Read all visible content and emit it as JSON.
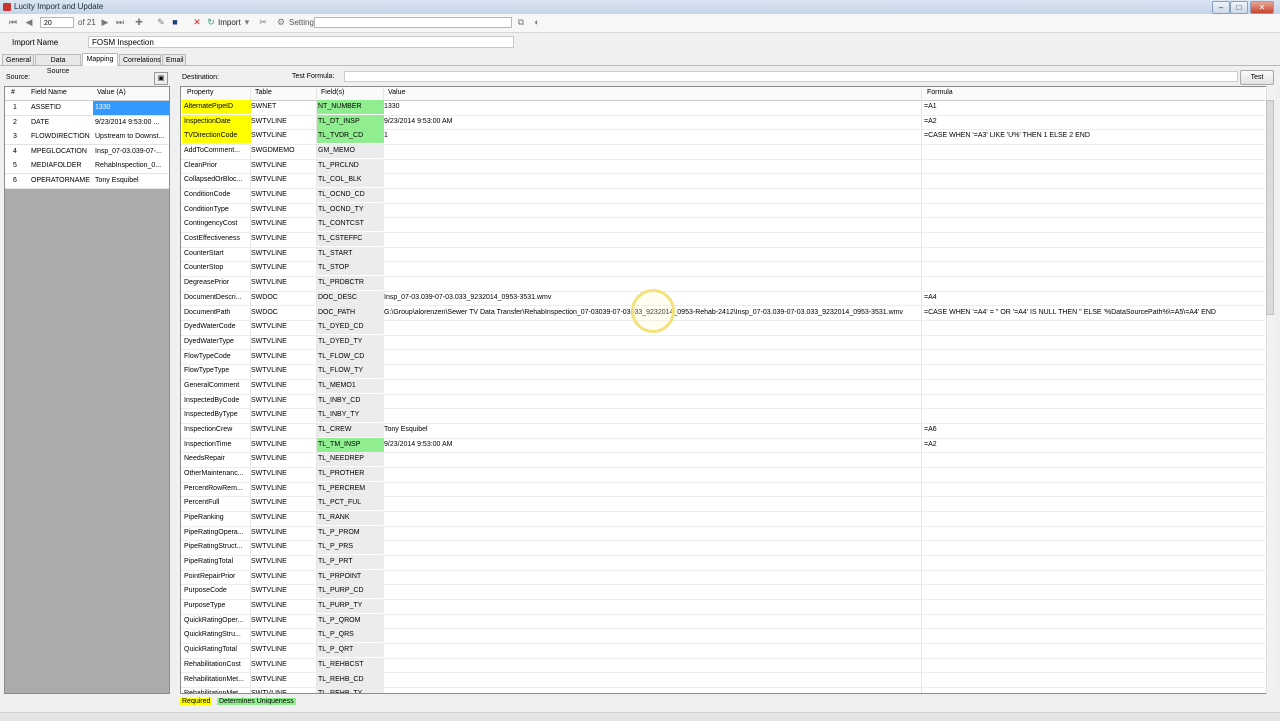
{
  "window": {
    "title": "Lucity Import and Update",
    "min": "–",
    "max": "□",
    "close": "✕"
  },
  "toolbar": {
    "record": "20",
    "of": "of 21",
    "import": "Import",
    "setting": "Setting:"
  },
  "import_name": {
    "label": "Import Name",
    "value": "FOSM Inspection"
  },
  "tabs": [
    "General",
    "Data Source",
    "Mapping",
    "Correlations",
    "Email"
  ],
  "source": {
    "label": "Source:",
    "headers": [
      "#",
      "Field Name",
      "Value (A)"
    ],
    "rows": [
      {
        "n": "1",
        "field": "ASSETID",
        "value": "1330"
      },
      {
        "n": "2",
        "field": "DATE",
        "value": "9/23/2014 9:53:00 ..."
      },
      {
        "n": "3",
        "field": "FLOWDIRECTION",
        "value": "Upstream to Downst..."
      },
      {
        "n": "4",
        "field": "MPEGLOCATION",
        "value": "Insp_07-03.039-07-..."
      },
      {
        "n": "5",
        "field": "MEDIAFOLDER",
        "value": "RehabInspection_0..."
      },
      {
        "n": "6",
        "field": "OPERATORNAME",
        "value": "Tony Esquibel"
      }
    ]
  },
  "destination": {
    "label": "Destination:",
    "test_formula_label": "Test Formula:",
    "test_button": "Test",
    "headers": [
      "Property",
      "Table",
      "Field(s)",
      "Value",
      "Formula"
    ],
    "rows": [
      {
        "p": "AlternatePipeID",
        "t": "SWNET",
        "f": "NT_NUMBER",
        "v": "1330",
        "fm": "=A1",
        "req": true,
        "uniq": true
      },
      {
        "p": "InspectionDate",
        "t": "SWTVLINE",
        "f": "TL_DT_INSP",
        "v": "9/23/2014 9:53:00 AM",
        "fm": "=A2",
        "req": true,
        "uniq": true
      },
      {
        "p": "TVDirectionCode",
        "t": "SWTVLINE",
        "f": "TL_TVDR_CD",
        "v": "1",
        "fm": "=CASE WHEN '=A3' LIKE 'U%' THEN 1 ELSE 2 END",
        "req": true,
        "uniq": true
      },
      {
        "p": "AddToComment...",
        "t": "SWGDMEMO",
        "f": "GM_MEMO",
        "v": "",
        "fm": ""
      },
      {
        "p": "CleanPrior",
        "t": "SWTVLINE",
        "f": "TL_PRCLND",
        "v": "",
        "fm": ""
      },
      {
        "p": "CollapsedOrBloc...",
        "t": "SWTVLINE",
        "f": "TL_COL_BLK",
        "v": "",
        "fm": ""
      },
      {
        "p": "ConditionCode",
        "t": "SWTVLINE",
        "f": "TL_OCND_CD",
        "v": "",
        "fm": ""
      },
      {
        "p": "ConditionType",
        "t": "SWTVLINE",
        "f": "TL_OCND_TY",
        "v": "",
        "fm": ""
      },
      {
        "p": "ContingencyCost",
        "t": "SWTVLINE",
        "f": "TL_CONTCST",
        "v": "",
        "fm": ""
      },
      {
        "p": "CostEffectiveness",
        "t": "SWTVLINE",
        "f": "TL_CSTEFFC",
        "v": "",
        "fm": ""
      },
      {
        "p": "CounterStart",
        "t": "SWTVLINE",
        "f": "TL_START",
        "v": "",
        "fm": ""
      },
      {
        "p": "CounterStop",
        "t": "SWTVLINE",
        "f": "TL_STOP",
        "v": "",
        "fm": ""
      },
      {
        "p": "DegreasePrior",
        "t": "SWTVLINE",
        "f": "TL_PRDBCTR",
        "v": "",
        "fm": ""
      },
      {
        "p": "DocumentDescri...",
        "t": "SWDOC",
        "f": "DOC_DESC",
        "v": "Insp_07-03.039-07-03.033_9232014_0953-3531.wmv",
        "fm": "=A4"
      },
      {
        "p": "DocumentPath",
        "t": "SWDOC",
        "f": "DOC_PATH",
        "v": "G:\\Group\\alorenzen\\Sewer TV Data Transfer\\RehabInspection_07-03039-07-03033_9232014_0953-Rehab-2412\\Insp_07-03.039-07-03.033_9232014_0953-3531.wmv",
        "fm": "=CASE WHEN '=A4' = '' OR '=A4' IS NULL THEN '' ELSE '%DataSourcePath%\\=A5\\=A4' END"
      },
      {
        "p": "DyedWaterCode",
        "t": "SWTVLINE",
        "f": "TL_DYED_CD",
        "v": "",
        "fm": ""
      },
      {
        "p": "DyedWaterType",
        "t": "SWTVLINE",
        "f": "TL_DYED_TY",
        "v": "",
        "fm": ""
      },
      {
        "p": "FlowTypeCode",
        "t": "SWTVLINE",
        "f": "TL_FLOW_CD",
        "v": "",
        "fm": ""
      },
      {
        "p": "FlowTypeType",
        "t": "SWTVLINE",
        "f": "TL_FLOW_TY",
        "v": "",
        "fm": ""
      },
      {
        "p": "GeneralComment",
        "t": "SWTVLINE",
        "f": "TL_MEMO1",
        "v": "",
        "fm": ""
      },
      {
        "p": "InspectedByCode",
        "t": "SWTVLINE",
        "f": "TL_INBY_CD",
        "v": "",
        "fm": ""
      },
      {
        "p": "InspectedByType",
        "t": "SWTVLINE",
        "f": "TL_INBY_TY",
        "v": "",
        "fm": ""
      },
      {
        "p": "InspectionCrew",
        "t": "SWTVLINE",
        "f": "TL_CREW",
        "v": "Tony Esquibel",
        "fm": "=A6"
      },
      {
        "p": "InspectionTime",
        "t": "SWTVLINE",
        "f": "TL_TM_INSP",
        "v": "9/23/2014 9:53:00 AM",
        "fm": "=A2",
        "uniq": true
      },
      {
        "p": "NeedsRepair",
        "t": "SWTVLINE",
        "f": "TL_NEEDREP",
        "v": "",
        "fm": ""
      },
      {
        "p": "OtherMaintenanc...",
        "t": "SWTVLINE",
        "f": "TL_PROTHER",
        "v": "",
        "fm": ""
      },
      {
        "p": "PercentRowRem...",
        "t": "SWTVLINE",
        "f": "TL_PERCREM",
        "v": "",
        "fm": ""
      },
      {
        "p": "PercentFull",
        "t": "SWTVLINE",
        "f": "TL_PCT_FUL",
        "v": "",
        "fm": ""
      },
      {
        "p": "PipeRanking",
        "t": "SWTVLINE",
        "f": "TL_RANK",
        "v": "",
        "fm": ""
      },
      {
        "p": "PipeRatingOpera...",
        "t": "SWTVLINE",
        "f": "TL_P_PROM",
        "v": "",
        "fm": ""
      },
      {
        "p": "PipeRatingStruct...",
        "t": "SWTVLINE",
        "f": "TL_P_PRS",
        "v": "",
        "fm": ""
      },
      {
        "p": "PipeRatingTotal",
        "t": "SWTVLINE",
        "f": "TL_P_PRT",
        "v": "",
        "fm": ""
      },
      {
        "p": "PointRepairPrior",
        "t": "SWTVLINE",
        "f": "TL_PRPOINT",
        "v": "",
        "fm": ""
      },
      {
        "p": "PurposeCode",
        "t": "SWTVLINE",
        "f": "TL_PURP_CD",
        "v": "",
        "fm": ""
      },
      {
        "p": "PurposeType",
        "t": "SWTVLINE",
        "f": "TL_PURP_TY",
        "v": "",
        "fm": ""
      },
      {
        "p": "QuickRatingOper...",
        "t": "SWTVLINE",
        "f": "TL_P_QROM",
        "v": "",
        "fm": ""
      },
      {
        "p": "QuickRatingStru...",
        "t": "SWTVLINE",
        "f": "TL_P_QRS",
        "v": "",
        "fm": ""
      },
      {
        "p": "QuickRatingTotal",
        "t": "SWTVLINE",
        "f": "TL_P_QRT",
        "v": "",
        "fm": ""
      },
      {
        "p": "RehabilitationCost",
        "t": "SWTVLINE",
        "f": "TL_REHBCST",
        "v": "",
        "fm": ""
      },
      {
        "p": "RehabilitationMet...",
        "t": "SWTVLINE",
        "f": "TL_REHB_CD",
        "v": "",
        "fm": ""
      },
      {
        "p": "RehabilitationMet...",
        "t": "SWTVLINE",
        "f": "TL_REHB_TY",
        "v": "",
        "fm": ""
      }
    ]
  },
  "legend": {
    "required": "Required",
    "unique": "Determines Uniqueness"
  },
  "colors": {
    "required": "#ffff00",
    "unique": "#90ee90",
    "selection": "#3399ff"
  }
}
